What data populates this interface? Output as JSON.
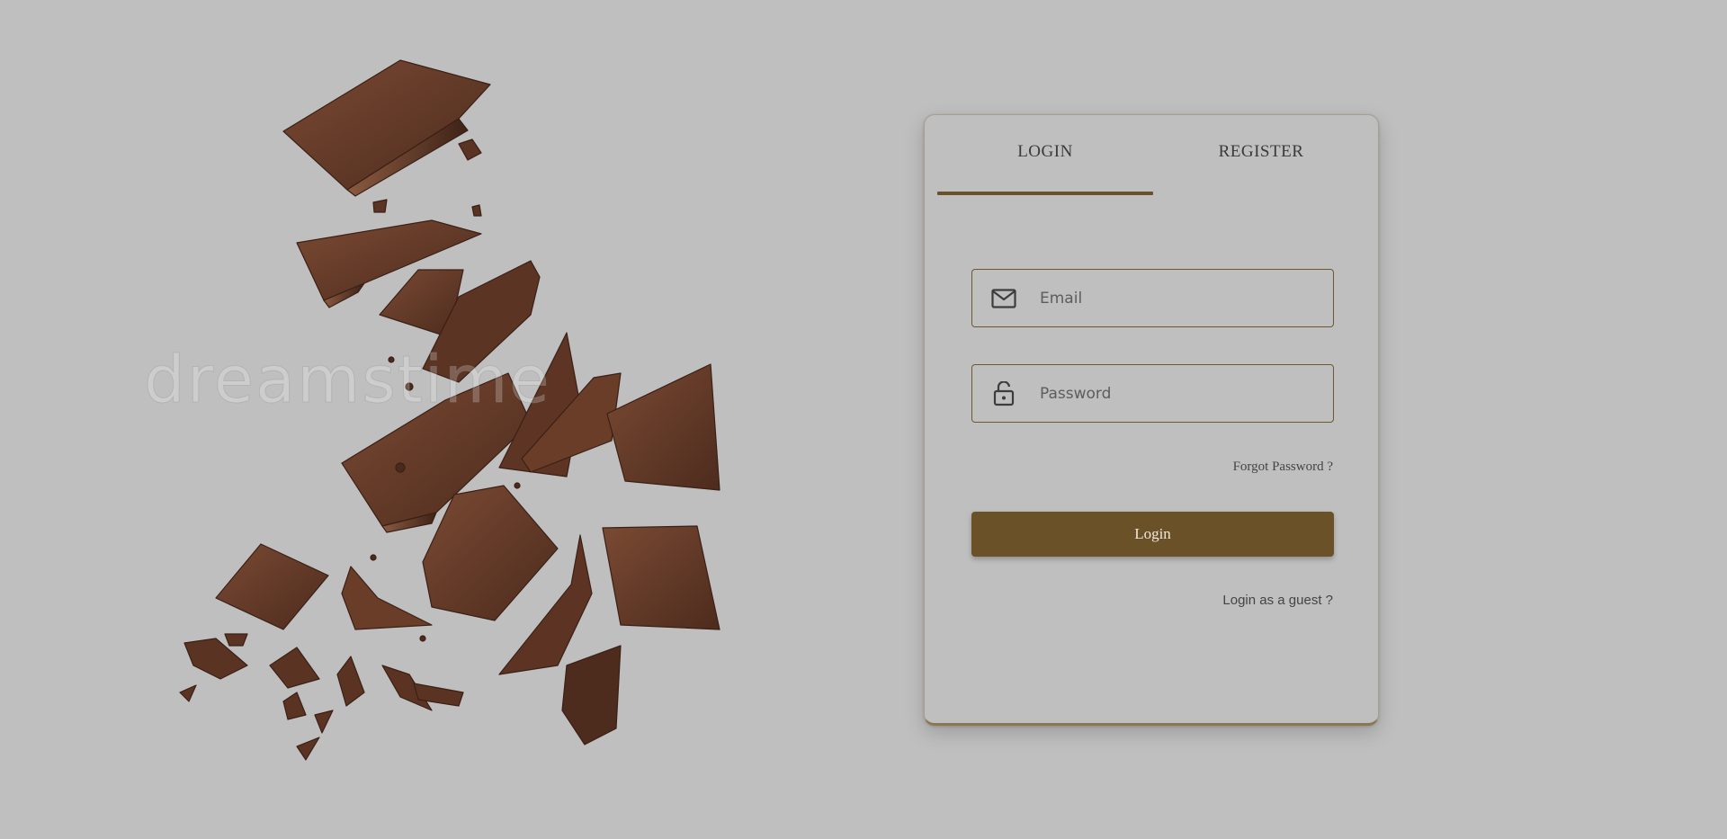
{
  "tabs": [
    {
      "label": "LOGIN",
      "active": true
    },
    {
      "label": "REGISTER",
      "active": false
    }
  ],
  "form": {
    "email_placeholder": "Email",
    "email_value": "",
    "password_placeholder": "Password",
    "password_value": "",
    "forgot_label": "Forgot Password ?",
    "login_button_label": "Login",
    "guest_label": "Login as a guest ?"
  },
  "icons": {
    "email": "mail-icon",
    "password": "lock-icon"
  },
  "illustration": {
    "subject": "chocolate-pieces",
    "watermark": "dreamstime"
  },
  "colors": {
    "background": "#bfbfbf",
    "accent": "#6b5128",
    "field_border": "#6e5631",
    "chocolate_dark": "#4a2a1c",
    "chocolate_mid": "#6b3f2a"
  }
}
